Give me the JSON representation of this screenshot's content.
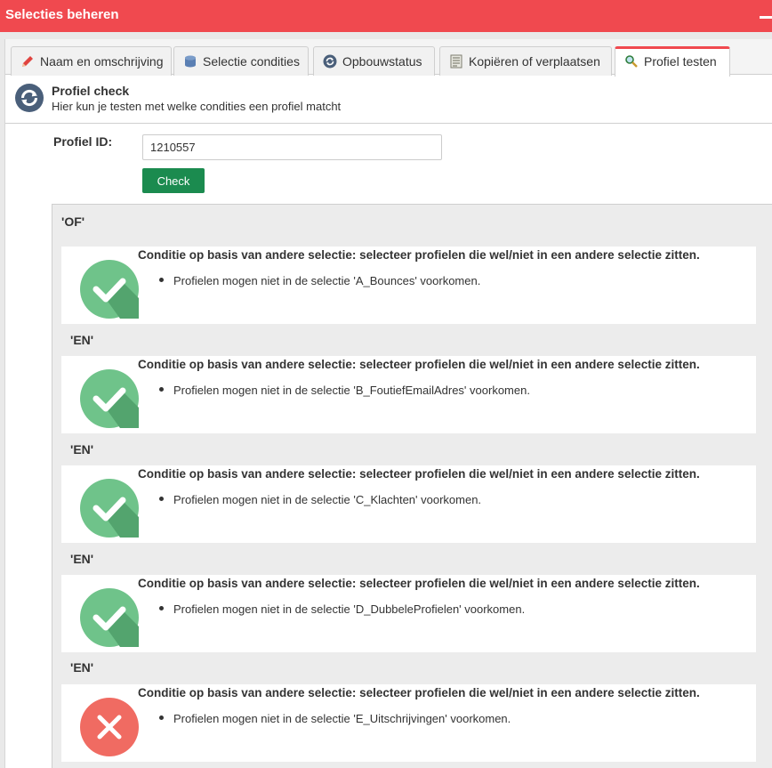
{
  "window": {
    "title": "Selecties beheren"
  },
  "colors": {
    "brand": "#f0494f",
    "success": "#6fc38a",
    "error": "#f06b62",
    "button": "#1b8b4f"
  },
  "tabs": [
    {
      "label": "Naam en omschrijving",
      "icon": "pencil-icon"
    },
    {
      "label": "Selectie condities",
      "icon": "database-icon"
    },
    {
      "label": "Opbouwstatus",
      "icon": "refresh-icon"
    },
    {
      "label": "Kopiëren of verplaatsen",
      "icon": "document-icon"
    },
    {
      "label": "Profiel testen",
      "icon": "magnifier-icon",
      "active": true
    }
  ],
  "header": {
    "title": "Profiel check",
    "subtitle": "Hier kun je testen met welke condities een profiel matcht"
  },
  "form": {
    "label": "Profiel ID:",
    "value": "1210557",
    "check_label": "Check"
  },
  "results": {
    "root_operator": "'OF'",
    "conditions": [
      {
        "operator": "",
        "title": "Conditie op basis van andere selectie: selecteer profielen die wel/niet in een andere selectie zitten.",
        "detail": "Profielen mogen niet in de selectie 'A_Bounces' voorkomen.",
        "status": "pass"
      },
      {
        "operator": "'EN'",
        "title": "Conditie op basis van andere selectie: selecteer profielen die wel/niet in een andere selectie zitten.",
        "detail": "Profielen mogen niet in de selectie 'B_FoutiefEmailAdres' voorkomen.",
        "status": "pass"
      },
      {
        "operator": "'EN'",
        "title": "Conditie op basis van andere selectie: selecteer profielen die wel/niet in een andere selectie zitten.",
        "detail": "Profielen mogen niet in de selectie 'C_Klachten' voorkomen.",
        "status": "pass"
      },
      {
        "operator": "'EN'",
        "title": "Conditie op basis van andere selectie: selecteer profielen die wel/niet in een andere selectie zitten.",
        "detail": "Profielen mogen niet in de selectie 'D_DubbeleProfielen' voorkomen.",
        "status": "pass"
      },
      {
        "operator": "'EN'",
        "title": "Conditie op basis van andere selectie: selecteer profielen die wel/niet in een andere selectie zitten.",
        "detail": "Profielen mogen niet in de selectie 'E_Uitschrijvingen' voorkomen.",
        "status": "fail"
      }
    ]
  }
}
